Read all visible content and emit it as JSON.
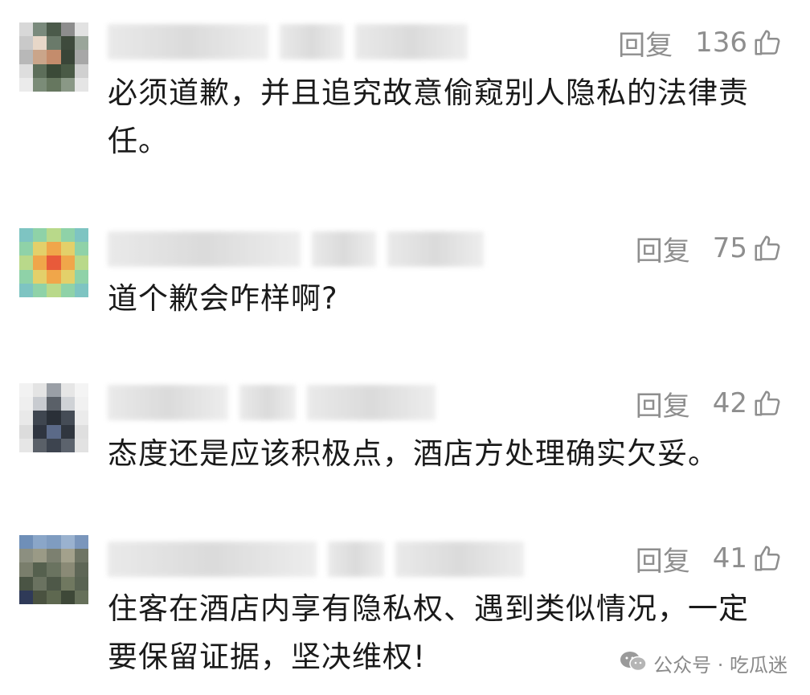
{
  "comments": [
    {
      "reply_label": "回复",
      "likes": "136",
      "text": "必须道歉，并且追究故意偷窥别人隐私的法律责任。",
      "avatar_colors": [
        "#d8d8d8",
        "#7a8a7c",
        "#4b5a4a",
        "#8d8d8d",
        "#e2e2e2",
        "#c9c9c9",
        "#e7d7c8",
        "#6a7a6a",
        "#3e4a3c",
        "#9aa59a",
        "#b8b8b8",
        "#caa58a",
        "#c48c6c",
        "#3a4538",
        "#a7a7a7",
        "#dedede",
        "#5d6e5a",
        "#3b4a38",
        "#4a5a46",
        "#d0d0d0",
        "#ebebeb",
        "#7b8c78",
        "#66775f",
        "#8a9886",
        "#e5e5e5"
      ]
    },
    {
      "reply_label": "回复",
      "likes": "75",
      "text": "道个歉会咋样啊?",
      "avatar_colors": [
        "#7ec4c2",
        "#8fd2a8",
        "#b9d98a",
        "#8fd2a8",
        "#7ec4c2",
        "#8fd2a8",
        "#e3d06a",
        "#f0a64a",
        "#e3d06a",
        "#8fd2a8",
        "#b9d98a",
        "#f0a64a",
        "#e85a3a",
        "#f0a64a",
        "#b9d98a",
        "#8fd2a8",
        "#e3d06a",
        "#f0a64a",
        "#e3d06a",
        "#8fd2a8",
        "#7ec4c2",
        "#8fd2a8",
        "#b9d98a",
        "#8fd2a8",
        "#7ec4c2"
      ]
    },
    {
      "reply_label": "回复",
      "likes": "42",
      "text": "态度还是应该积极点，酒店方处理确实欠妥。",
      "avatar_colors": [
        "#f2f2f2",
        "#e4e4e4",
        "#9a9fa6",
        "#e6e6e6",
        "#f4f4f4",
        "#efefef",
        "#c8cbd0",
        "#5a6068",
        "#cfd2d6",
        "#f1f1f1",
        "#e9e9e9",
        "#3f4650",
        "#2a3038",
        "#454c56",
        "#ebebeb",
        "#dcdcdc",
        "#2f3540",
        "#5b6a88",
        "#30363f",
        "#dfdfdf",
        "#e6e6e6",
        "#5a6068",
        "#3d444f",
        "#5c636d",
        "#e2e2e2"
      ]
    },
    {
      "reply_label": "回复",
      "likes": "41",
      "text": "住客在酒店内享有隐私权、遇到类似情况，一定要保留证据，坚决维权!",
      "avatar_colors": [
        "#6f8fb8",
        "#8aa6c8",
        "#7f9cc0",
        "#9ab2cf",
        "#7a96bc",
        "#8c8f80",
        "#9a9a86",
        "#7c8070",
        "#a3a18c",
        "#6e7464",
        "#7a7e6c",
        "#55604e",
        "#6a7360",
        "#8a8a76",
        "#5e6656",
        "#4a5444",
        "#6a7260",
        "#4e5848",
        "#707860",
        "#596352",
        "#2f3a58",
        "#4a5240",
        "#5e6850",
        "#3e4838",
        "#66705a"
      ]
    }
  ],
  "watermark": {
    "text": "公众号 · 吃瓜迷",
    "icon": "wechat-icon"
  }
}
